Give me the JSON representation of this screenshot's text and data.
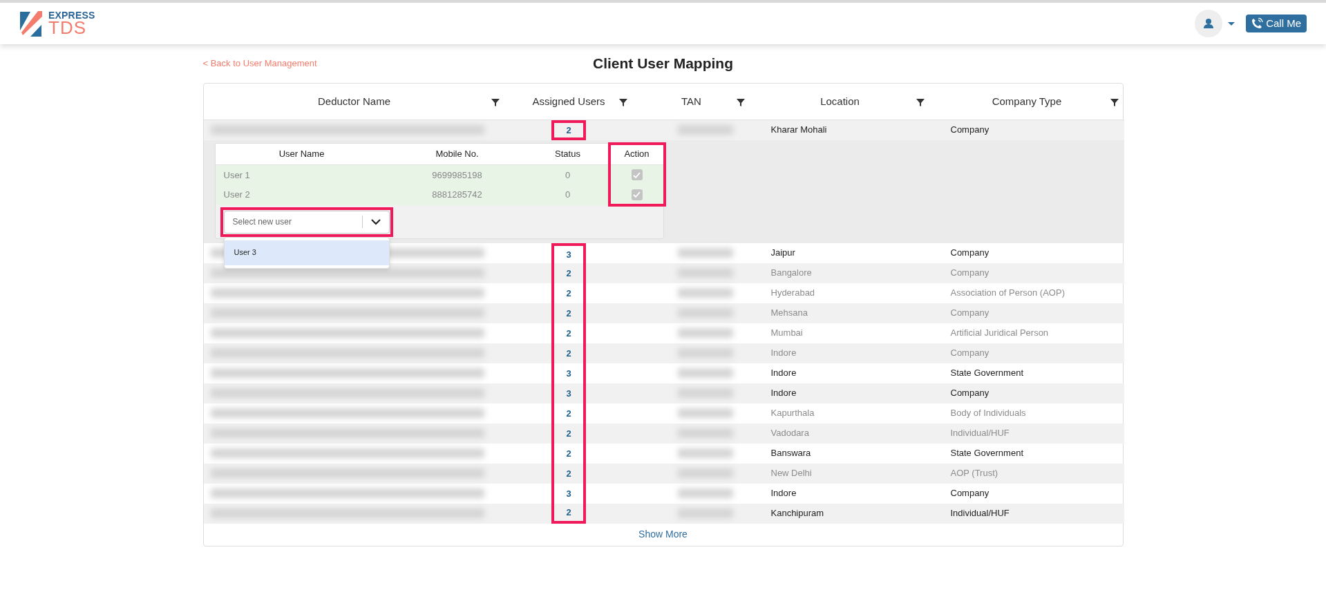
{
  "header": {
    "logo_top": "EXPRESS",
    "logo_bottom": "TDS",
    "call_button": "Call Me"
  },
  "back_link": "< Back to User Management",
  "title": "Client User Mapping",
  "table": {
    "columns": [
      {
        "label": "Deductor Name"
      },
      {
        "label": "Assigned Users"
      },
      {
        "label": "TAN"
      },
      {
        "label": "Location"
      },
      {
        "label": "Company Type"
      }
    ],
    "rows": [
      {
        "assigned": "2",
        "location": "Kharar Mohali",
        "company_type": "Company",
        "muted": false,
        "expanded": true,
        "highlighted": true
      },
      {
        "assigned": "3",
        "location": "Jaipur",
        "company_type": "Company",
        "muted": false,
        "expanded": false,
        "highlighted": true
      },
      {
        "assigned": "2",
        "location": "Bangalore",
        "company_type": "Company",
        "muted": true,
        "expanded": false,
        "highlighted": true
      },
      {
        "assigned": "2",
        "location": "Hyderabad",
        "company_type": "Association of Person (AOP)",
        "muted": true,
        "expanded": false,
        "highlighted": true
      },
      {
        "assigned": "2",
        "location": "Mehsana",
        "company_type": "Company",
        "muted": true,
        "expanded": false,
        "highlighted": true
      },
      {
        "assigned": "2",
        "location": "Mumbai",
        "company_type": "Artificial Juridical Person",
        "muted": true,
        "expanded": false,
        "highlighted": true
      },
      {
        "assigned": "2",
        "location": "Indore",
        "company_type": "Company",
        "muted": true,
        "expanded": false,
        "highlighted": true
      },
      {
        "assigned": "3",
        "location": "Indore",
        "company_type": "State Government",
        "muted": false,
        "expanded": false,
        "highlighted": true
      },
      {
        "assigned": "3",
        "location": "Indore",
        "company_type": "Company",
        "muted": false,
        "expanded": false,
        "highlighted": true
      },
      {
        "assigned": "2",
        "location": "Kapurthala",
        "company_type": "Body of Individuals",
        "muted": true,
        "expanded": false,
        "highlighted": true
      },
      {
        "assigned": "2",
        "location": "Vadodara",
        "company_type": "Individual/HUF",
        "muted": true,
        "expanded": false,
        "highlighted": true
      },
      {
        "assigned": "2",
        "location": "Banswara",
        "company_type": "State Government",
        "muted": false,
        "expanded": false,
        "highlighted": true
      },
      {
        "assigned": "2",
        "location": "New Delhi",
        "company_type": "AOP (Trust)",
        "muted": true,
        "expanded": false,
        "highlighted": true
      },
      {
        "assigned": "3",
        "location": "Indore",
        "company_type": "Company",
        "muted": false,
        "expanded": false,
        "highlighted": true
      },
      {
        "assigned": "2",
        "location": "Kanchipuram",
        "company_type": "Individual/HUF",
        "muted": false,
        "expanded": false,
        "highlighted": true
      }
    ],
    "show_more": "Show More"
  },
  "user_panel": {
    "columns": [
      "User Name",
      "Mobile No.",
      "Status",
      "Action"
    ],
    "action_highlighted": true,
    "users": [
      {
        "name": "User 1",
        "mobile": "9699985198",
        "status": "0",
        "checked": true,
        "disabled": true
      },
      {
        "name": "User 2",
        "mobile": "8881285742",
        "status": "0",
        "checked": true,
        "disabled": true
      }
    ],
    "select": {
      "placeholder": "Select new user",
      "highlighted": true,
      "open": true,
      "options": [
        {
          "label": "User 3",
          "selected": true
        }
      ]
    }
  }
}
